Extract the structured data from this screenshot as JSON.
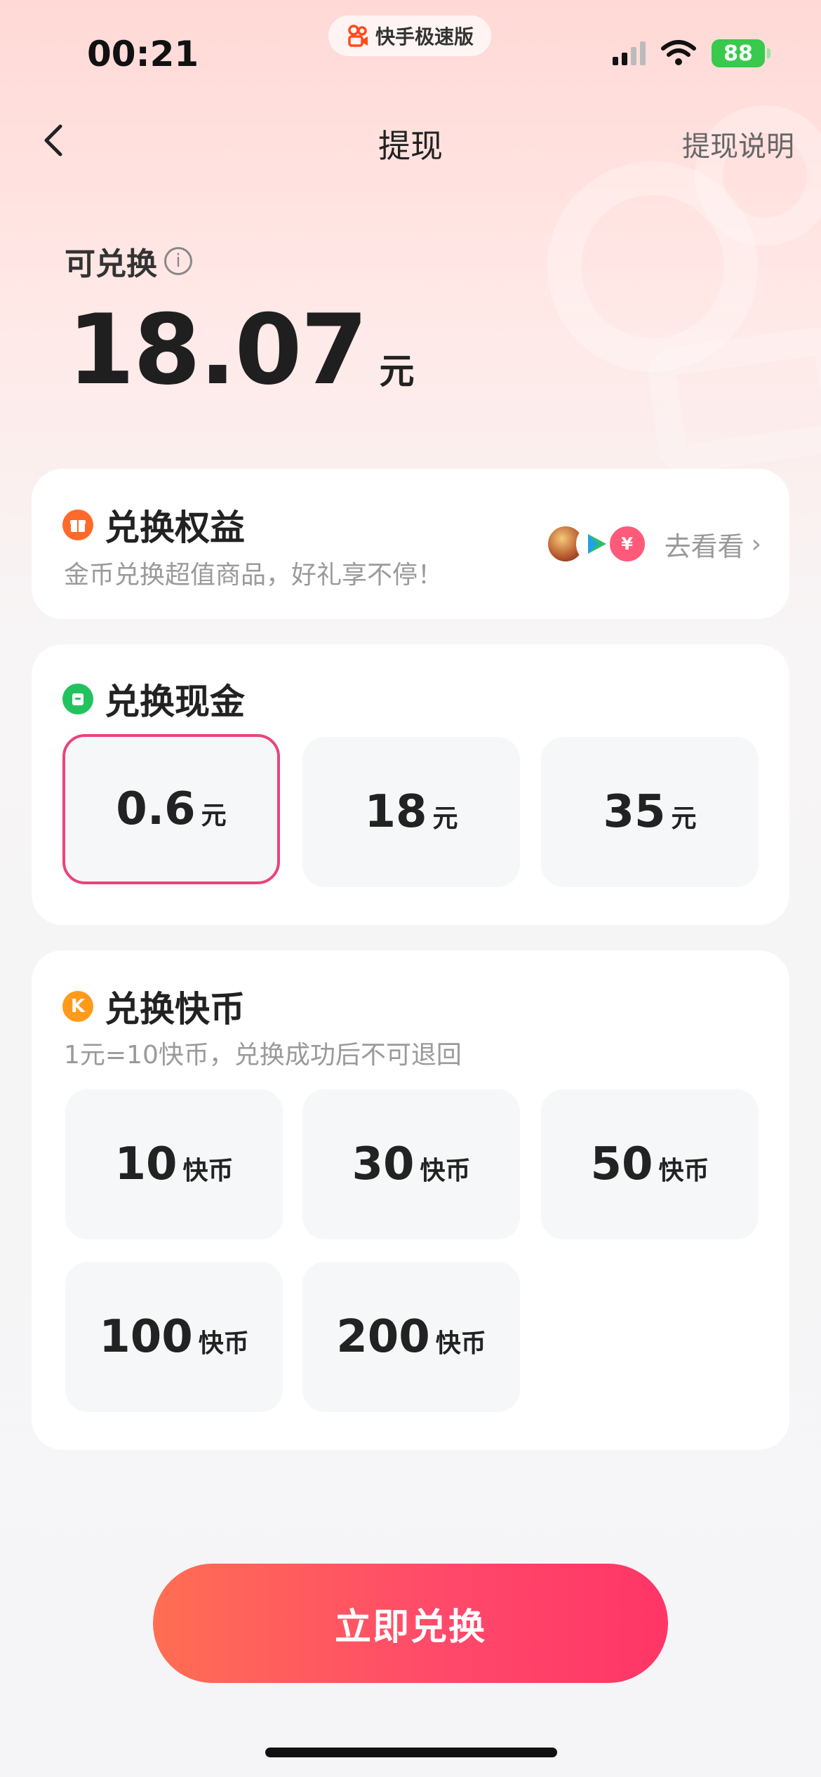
{
  "status_bar": {
    "time": "00:21",
    "app_name": "快手极速版",
    "battery": "88"
  },
  "nav": {
    "title": "提现",
    "right_link": "提现说明"
  },
  "balance": {
    "label": "可兑换",
    "amount": "18.07",
    "unit": "元"
  },
  "perks": {
    "title": "兑换权益",
    "subtitle": "金币兑换超值商品，好礼享不停！",
    "link": "去看看",
    "avatar_badge": "¥"
  },
  "cash": {
    "title": "兑换现金",
    "options": [
      {
        "value": "0.6",
        "unit": "元",
        "selected": true
      },
      {
        "value": "18",
        "unit": "元",
        "selected": false
      },
      {
        "value": "35",
        "unit": "元",
        "selected": false
      }
    ]
  },
  "coins": {
    "title": "兑换快币",
    "icon_letter": "K",
    "subtitle": "1元=10快币，兑换成功后不可退回",
    "options": [
      {
        "value": "10",
        "unit": "快币"
      },
      {
        "value": "30",
        "unit": "快币"
      },
      {
        "value": "50",
        "unit": "快币"
      },
      {
        "value": "100",
        "unit": "快币"
      },
      {
        "value": "200",
        "unit": "快币"
      }
    ]
  },
  "cta": {
    "label": "立即兑换"
  },
  "colors": {
    "accent": "#ff4a6a",
    "selected_border": "#e8457a",
    "perk_icon": "#ff6a2b",
    "cash_icon": "#22c35e",
    "coin_icon": "#ff9a1a"
  }
}
